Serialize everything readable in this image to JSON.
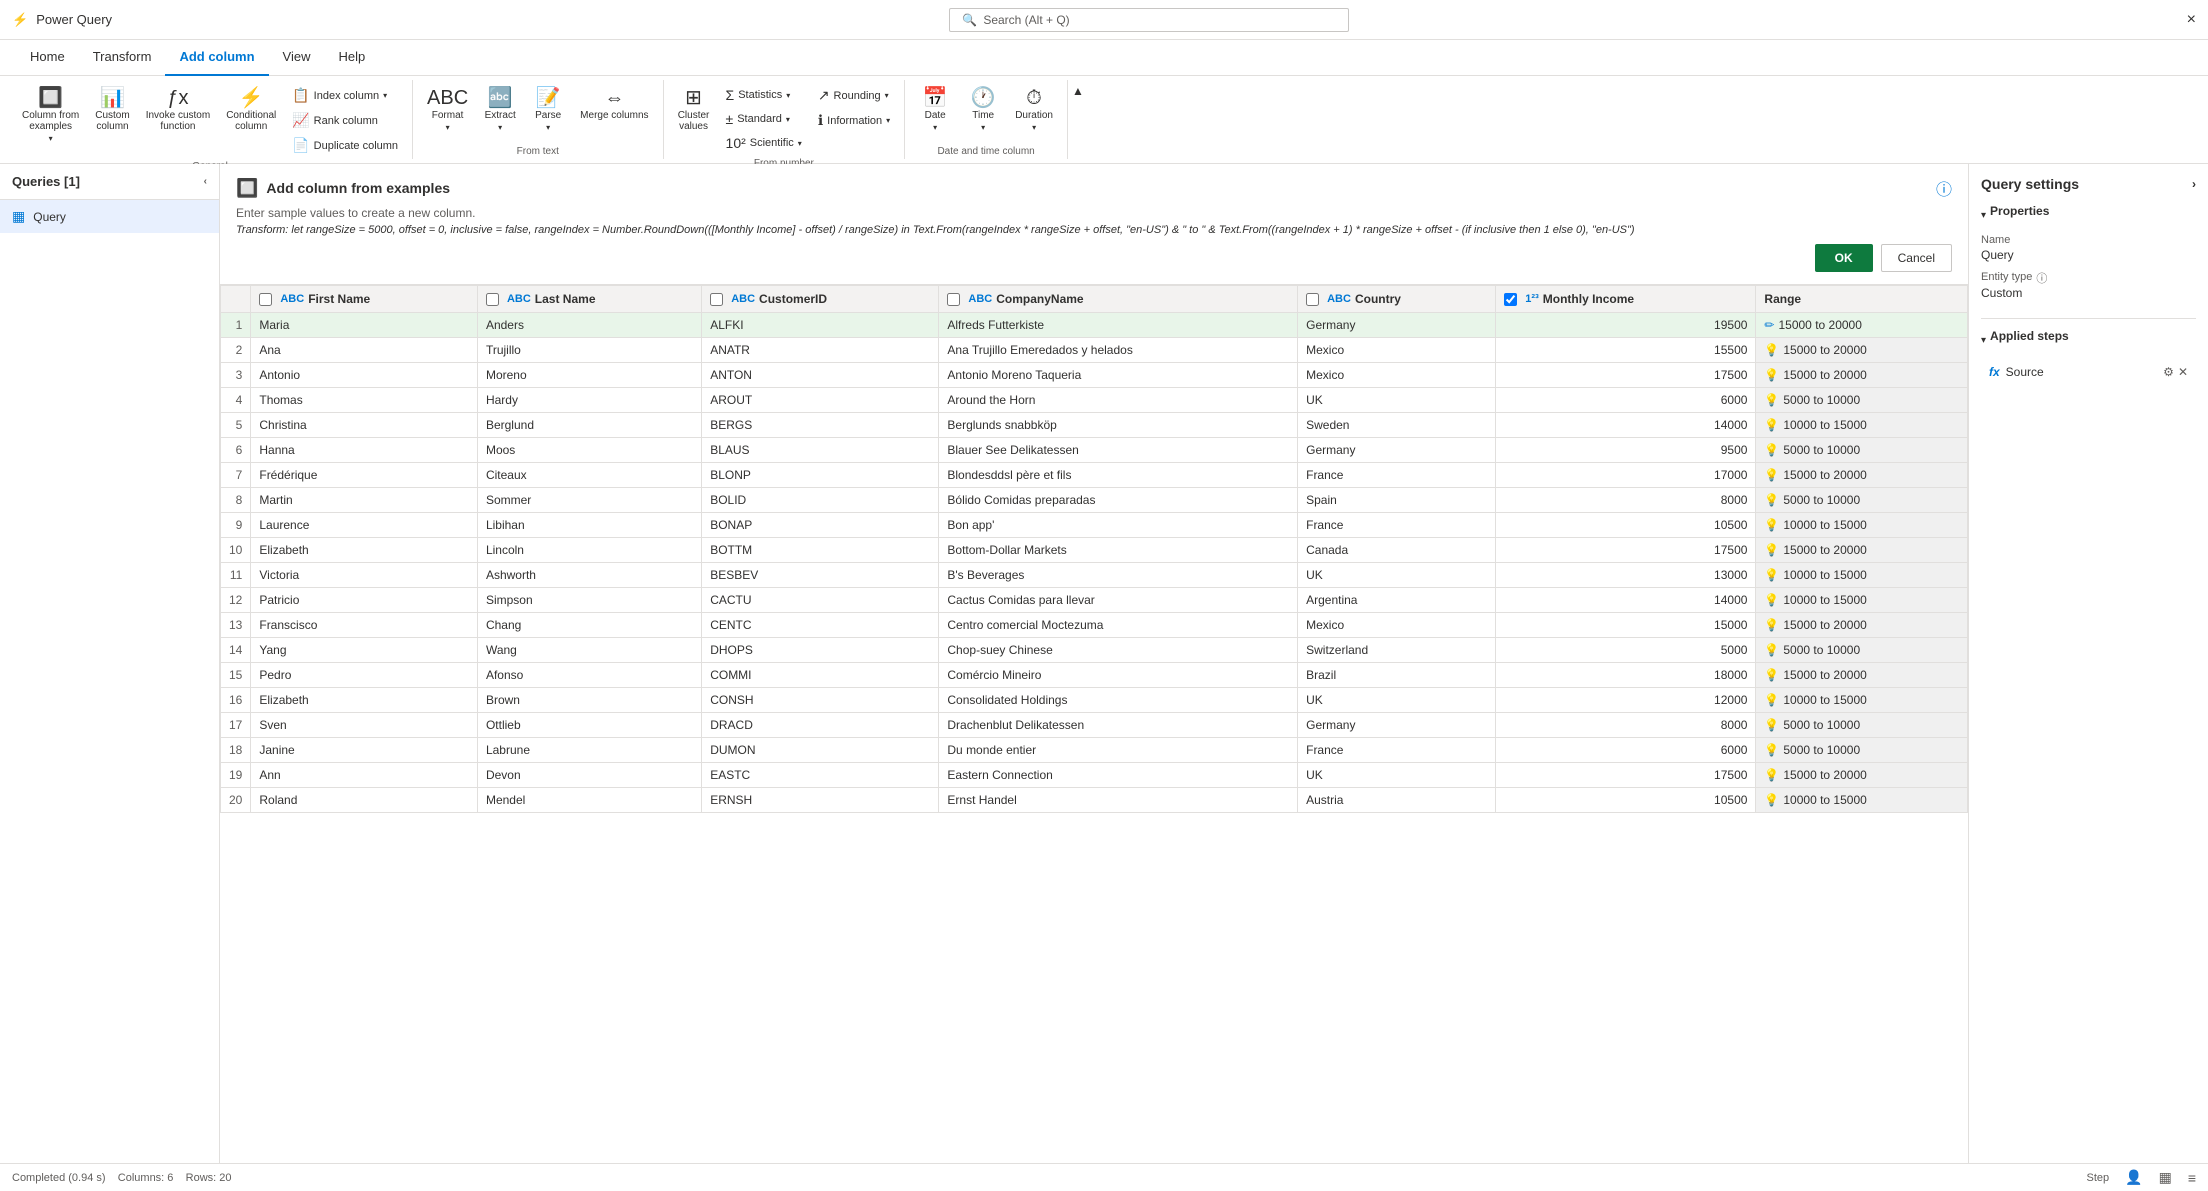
{
  "app": {
    "title": "Power Query",
    "close_label": "×"
  },
  "search": {
    "placeholder": "Search (Alt + Q)"
  },
  "tabs": [
    {
      "label": "Home",
      "active": false
    },
    {
      "label": "Transform",
      "active": false
    },
    {
      "label": "Add column",
      "active": true
    },
    {
      "label": "View",
      "active": false
    },
    {
      "label": "Help",
      "active": false
    }
  ],
  "ribbon": {
    "general_group_label": "General",
    "from_text_group_label": "From text",
    "from_number_group_label": "From number",
    "date_time_group_label": "Date and time column",
    "buttons": {
      "column_from_examples": "Column from\nexamples",
      "custom_column": "Custom\ncolumn",
      "invoke_custom_function": "Invoke custom\nfunction",
      "conditional_column": "Conditional\ncolumn",
      "index_column": "Index column",
      "rank_column": "Rank column",
      "duplicate_column": "Duplicate column",
      "format": "Format",
      "extract": "Extract",
      "parse": "Parse",
      "merge_columns": "Merge columns",
      "cluster_values": "Cluster\nvalues",
      "statistics": "Statistics",
      "standard": "Standard",
      "scientific": "Scientific",
      "rounding": "Rounding",
      "information": "Information",
      "date": "Date",
      "time": "Time",
      "duration": "Duration"
    }
  },
  "sidebar": {
    "header": "Queries [1]",
    "items": [
      {
        "label": "Query",
        "icon": "table"
      }
    ]
  },
  "examples_panel": {
    "title": "Add column from examples",
    "subtitle": "Enter sample values to create a new column.",
    "formula": "Transform: let rangeSize = 5000, offset = 0, inclusive = false, rangeIndex = Number.RoundDown(([Monthly Income] - offset) / rangeSize) in Text.From(rangeIndex * rangeSize + offset, \"en-US\") & \" to \" & Text.From((rangeIndex + 1) * rangeSize + offset - (if inclusive then 1 else 0), \"en-US\")",
    "ok_label": "OK",
    "cancel_label": "Cancel"
  },
  "grid": {
    "columns": [
      {
        "label": "First Name",
        "type": "ABC"
      },
      {
        "label": "Last Name",
        "type": "ABC"
      },
      {
        "label": "CustomerID",
        "type": "ABC"
      },
      {
        "label": "CompanyName",
        "type": "ABC"
      },
      {
        "label": "Country",
        "type": "ABC"
      },
      {
        "label": "Monthly Income",
        "type": "123"
      },
      {
        "label": "Range",
        "type": ""
      }
    ],
    "rows": [
      {
        "num": 1,
        "firstName": "Maria",
        "lastName": "Anders",
        "customerId": "ALFKI",
        "company": "Alfreds Futterkiste",
        "country": "Germany",
        "income": "19500",
        "range": "15000 to 20000",
        "rangeType": "edit"
      },
      {
        "num": 2,
        "firstName": "Ana",
        "lastName": "Trujillo",
        "customerId": "ANATR",
        "company": "Ana Trujillo Emeredados y helados",
        "country": "Mexico",
        "income": "15500",
        "range": "15000 to 20000",
        "rangeType": "bulb"
      },
      {
        "num": 3,
        "firstName": "Antonio",
        "lastName": "Moreno",
        "customerId": "ANTON",
        "company": "Antonio Moreno Taqueria",
        "country": "Mexico",
        "income": "17500",
        "range": "15000 to 20000",
        "rangeType": "bulb"
      },
      {
        "num": 4,
        "firstName": "Thomas",
        "lastName": "Hardy",
        "customerId": "AROUT",
        "company": "Around the Horn",
        "country": "UK",
        "income": "6000",
        "range": "5000 to 10000",
        "rangeType": "bulb"
      },
      {
        "num": 5,
        "firstName": "Christina",
        "lastName": "Berglund",
        "customerId": "BERGS",
        "company": "Berglunds snabbköp",
        "country": "Sweden",
        "income": "14000",
        "range": "10000 to 15000",
        "rangeType": "bulb"
      },
      {
        "num": 6,
        "firstName": "Hanna",
        "lastName": "Moos",
        "customerId": "BLAUS",
        "company": "Blauer See Delikatessen",
        "country": "Germany",
        "income": "9500",
        "range": "5000 to 10000",
        "rangeType": "bulb"
      },
      {
        "num": 7,
        "firstName": "Frédérique",
        "lastName": "Citeaux",
        "customerId": "BLONP",
        "company": "Blondesddsl père et fils",
        "country": "France",
        "income": "17000",
        "range": "15000 to 20000",
        "rangeType": "bulb"
      },
      {
        "num": 8,
        "firstName": "Martin",
        "lastName": "Sommer",
        "customerId": "BOLID",
        "company": "Bólido Comidas preparadas",
        "country": "Spain",
        "income": "8000",
        "range": "5000 to 10000",
        "rangeType": "bulb"
      },
      {
        "num": 9,
        "firstName": "Laurence",
        "lastName": "Libihan",
        "customerId": "BONAP",
        "company": "Bon app'",
        "country": "France",
        "income": "10500",
        "range": "10000 to 15000",
        "rangeType": "bulb"
      },
      {
        "num": 10,
        "firstName": "Elizabeth",
        "lastName": "Lincoln",
        "customerId": "BOTTM",
        "company": "Bottom-Dollar Markets",
        "country": "Canada",
        "income": "17500",
        "range": "15000 to 20000",
        "rangeType": "bulb"
      },
      {
        "num": 11,
        "firstName": "Victoria",
        "lastName": "Ashworth",
        "customerId": "BESBEV",
        "company": "B's Beverages",
        "country": "UK",
        "income": "13000",
        "range": "10000 to 15000",
        "rangeType": "bulb"
      },
      {
        "num": 12,
        "firstName": "Patricio",
        "lastName": "Simpson",
        "customerId": "CACTU",
        "company": "Cactus Comidas para llevar",
        "country": "Argentina",
        "income": "14000",
        "range": "10000 to 15000",
        "rangeType": "bulb"
      },
      {
        "num": 13,
        "firstName": "Franscisco",
        "lastName": "Chang",
        "customerId": "CENTC",
        "company": "Centro comercial Moctezuma",
        "country": "Mexico",
        "income": "15000",
        "range": "15000 to 20000",
        "rangeType": "bulb"
      },
      {
        "num": 14,
        "firstName": "Yang",
        "lastName": "Wang",
        "customerId": "DHOPS",
        "company": "Chop-suey Chinese",
        "country": "Switzerland",
        "income": "5000",
        "range": "5000 to 10000",
        "rangeType": "bulb"
      },
      {
        "num": 15,
        "firstName": "Pedro",
        "lastName": "Afonso",
        "customerId": "COMMI",
        "company": "Comércio Mineiro",
        "country": "Brazil",
        "income": "18000",
        "range": "15000 to 20000",
        "rangeType": "bulb"
      },
      {
        "num": 16,
        "firstName": "Elizabeth",
        "lastName": "Brown",
        "customerId": "CONSH",
        "company": "Consolidated Holdings",
        "country": "UK",
        "income": "12000",
        "range": "10000 to 15000",
        "rangeType": "bulb"
      },
      {
        "num": 17,
        "firstName": "Sven",
        "lastName": "Ottlieb",
        "customerId": "DRACD",
        "company": "Drachenblut Delikatessen",
        "country": "Germany",
        "income": "8000",
        "range": "5000 to 10000",
        "rangeType": "bulb"
      },
      {
        "num": 18,
        "firstName": "Janine",
        "lastName": "Labrune",
        "customerId": "DUMON",
        "company": "Du monde entier",
        "country": "France",
        "income": "6000",
        "range": "5000 to 10000",
        "rangeType": "bulb"
      },
      {
        "num": 19,
        "firstName": "Ann",
        "lastName": "Devon",
        "customerId": "EASTC",
        "company": "Eastern Connection",
        "country": "UK",
        "income": "17500",
        "range": "15000 to 20000",
        "rangeType": "bulb"
      },
      {
        "num": 20,
        "firstName": "Roland",
        "lastName": "Mendel",
        "customerId": "ERNSH",
        "company": "Ernst Handel",
        "country": "Austria",
        "income": "10500",
        "range": "10000 to 15000",
        "rangeType": "bulb"
      }
    ]
  },
  "query_settings": {
    "title": "Query settings",
    "properties_label": "Properties",
    "name_label": "Name",
    "name_value": "Query",
    "entity_type_label": "Entity type",
    "entity_type_value": "Custom",
    "applied_steps_label": "Applied steps",
    "steps": [
      {
        "label": "Source"
      }
    ]
  },
  "status_bar": {
    "status": "Completed (0.94 s)",
    "columns_label": "Columns: 6",
    "rows_label": "Rows: 20",
    "step_label": "Step"
  }
}
